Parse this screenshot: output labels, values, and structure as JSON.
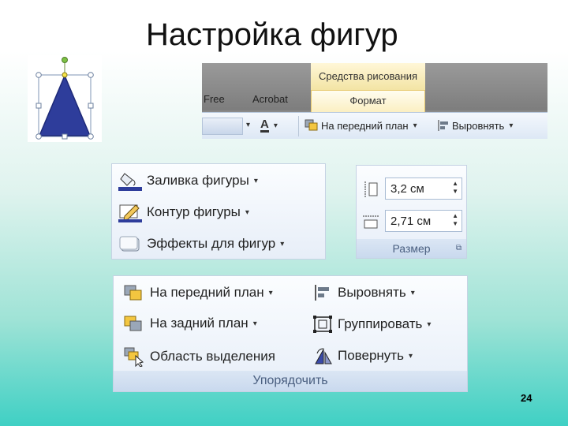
{
  "slide": {
    "title": "Настройка фигур",
    "page_number": "24"
  },
  "ribbon": {
    "context_tab": "Средства рисования",
    "tabs": [
      "Free",
      "Acrobat",
      "Формат"
    ],
    "tools": {
      "bring_forward": "На передний план",
      "align": "Выровнять"
    }
  },
  "shape_styles": {
    "fill": "Заливка фигуры",
    "outline": "Контур фигуры",
    "effects": "Эффекты для фигур"
  },
  "size": {
    "height_value": "3,2 см",
    "width_value": "2,71 см",
    "group_label": "Размер"
  },
  "arrange": {
    "bring_forward": "На передний план",
    "send_backward": "На задний план",
    "selection_pane": "Область выделения",
    "align": "Выровнять",
    "group": "Группировать",
    "rotate": "Повернуть",
    "group_label": "Упорядочить"
  },
  "colors": {
    "triangle_fill": "#2e3d9b",
    "accent_gold": "#f3e4a4",
    "ribbon_blue": "#dde8f5"
  },
  "icons": {
    "fill": "paint-bucket-icon",
    "outline": "pencil-icon",
    "effects": "shape-effects-icon",
    "height": "shape-height-icon",
    "width": "shape-width-icon",
    "bring_forward": "bring-forward-icon",
    "send_backward": "send-backward-icon",
    "selection_pane": "selection-pane-icon",
    "align": "align-icon",
    "group": "group-icon",
    "rotate": "rotate-icon",
    "dialog_launcher": "dialog-launcher-icon",
    "font_color": "font-color-icon"
  }
}
